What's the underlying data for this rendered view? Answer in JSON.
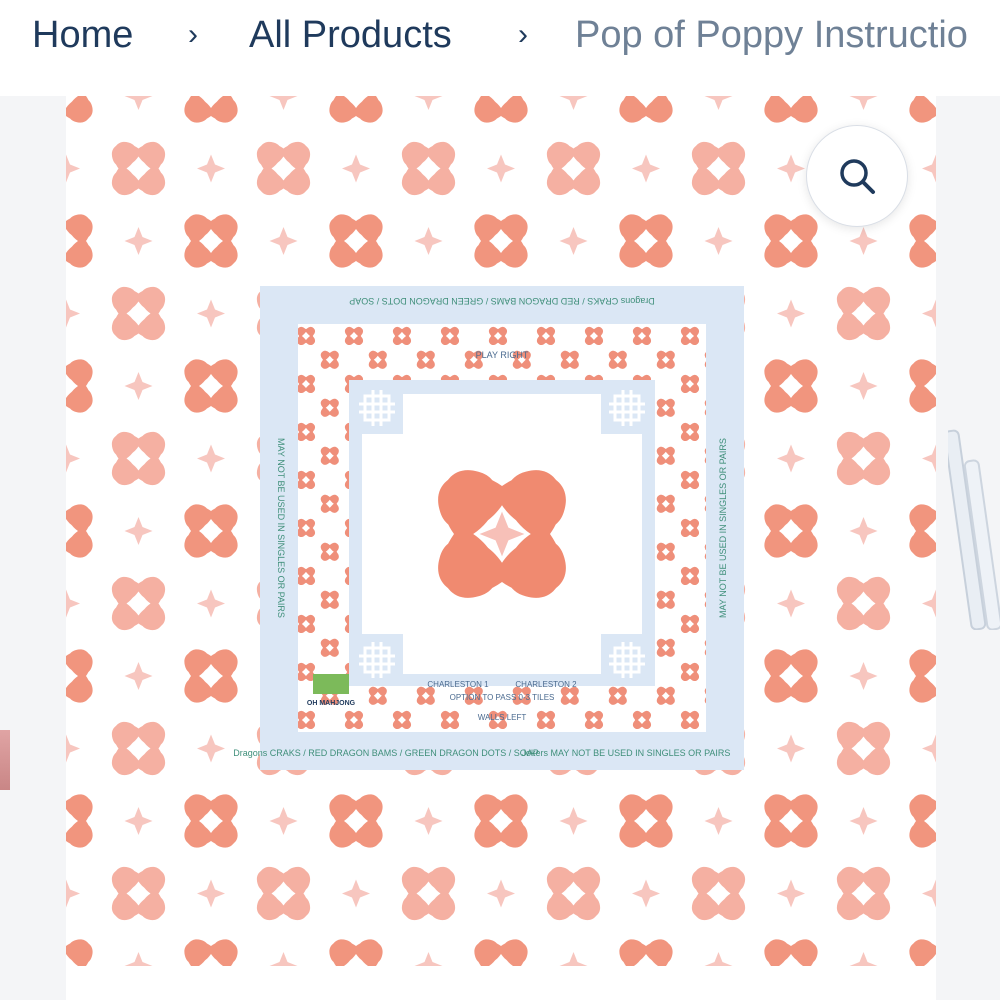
{
  "breadcrumb": {
    "home": "Home",
    "all_products": "All Products",
    "current": "Pop of Poppy Instructio",
    "separator": "›"
  },
  "zoom": {
    "icon": "search-icon",
    "label": "Zoom image"
  },
  "colors": {
    "coral": "#ef8f7a",
    "coral_deep": "#e8705a",
    "pink_light": "#f7c0b8",
    "blue_light": "#dbe7f5",
    "navy": "#1f3a5c"
  },
  "mat": {
    "border_text_top": "Dragons  CRAKS / RED DRAGON  BAMS / GREEN DRAGON  DOTS / SOAP",
    "border_text_top_script": "Jokers",
    "border_text_joker": "MAY NOT BE USED IN SINGLES OR PAIRS",
    "border_text_bottom": "Dragons  CRAKS / RED DRAGON  BAMS / GREEN DRAGON  DOTS / SOAP",
    "border_text_bottom_joker": "Jokers  MAY NOT BE USED IN SINGLES OR PAIRS",
    "charleston_1": "CHARLESTON 1",
    "charleston_2": "CHARLESTON 2",
    "play_right": "PLAY RIGHT",
    "walls_left": "WALLS LEFT",
    "option": "OPTION TO PASS 0-3 TILES",
    "brand": "OH MAHJONG"
  }
}
